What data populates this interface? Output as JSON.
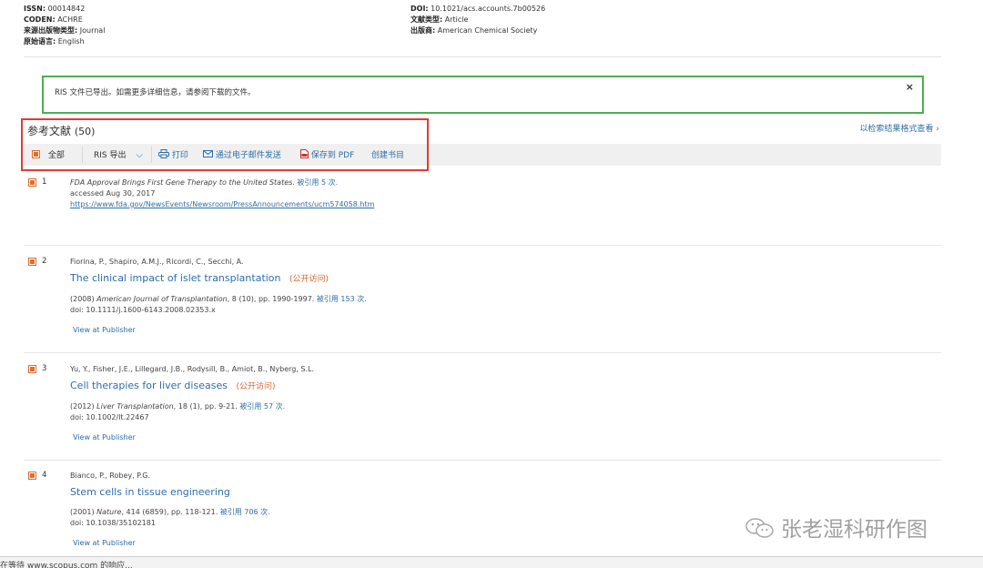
{
  "record_meta": {
    "left": [
      {
        "key": "ISSN:",
        "value": "00014842"
      },
      {
        "key": "CODEN:",
        "value": "ACHRE"
      },
      {
        "key": "来源出版物类型:",
        "value": "Journal"
      },
      {
        "key": "原始语言:",
        "value": "English"
      }
    ],
    "right": [
      {
        "key": "DOI:",
        "value": "10.1021/acs.accounts.7b00526"
      },
      {
        "key": "文献类型:",
        "value": "Article"
      },
      {
        "key": "出版商:",
        "value": "American Chemical Society"
      }
    ]
  },
  "notice": {
    "text": "RIS 文件已导出。如需更多详细信息，请参阅下载的文件。",
    "close": "×"
  },
  "references": {
    "title": "参考文献",
    "count": "(50)",
    "view_link": "以检索结果格式查看 ›"
  },
  "toolbar": {
    "select_all": "全部",
    "ris_export": "RIS 导出",
    "chevron": "⌵",
    "print": "打印",
    "email": "通过电子邮件发送",
    "save_pdf": "保存到 PDF",
    "create_bib": "创建书目"
  },
  "refs": [
    {
      "num": "1",
      "line1_italic": "FDA Approval Brings First Gene Therapy to the United States.",
      "line1_cited": "被引用 5 次.",
      "line2": "accessed Aug 30, 2017",
      "url": "https://www.fda.gov/NewsEvents/Newsroom/PressAnnouncements/ucm574058.htm"
    },
    {
      "num": "2",
      "authors": "Fiorina, P., Shapiro, A.M.J., Ricordi, C., Secchi, A.",
      "title": "The clinical impact of islet transplantation",
      "oa": "(公开访问)",
      "src_year": "(2008)",
      "src_journal": "American Journal of Transplantation",
      "src_detail": ", 8 (10), pp. 1990-1997.",
      "cited": "被引用 153 次.",
      "doi": "doi: 10.1111/j.1600-6143.2008.02353.x",
      "view": "View at Publisher"
    },
    {
      "num": "3",
      "authors": "Yu, Y., Fisher, J.E., Lillegard, J.B., Rodysill, B., Amiot, B., Nyberg, S.L.",
      "title": "Cell therapies for liver diseases",
      "oa": "(公开访问)",
      "src_year": "(2012)",
      "src_journal": "Liver Transplantation",
      "src_detail": ", 18 (1), pp. 9-21.",
      "cited": "被引用 57 次.",
      "doi": "doi: 10.1002/lt.22467",
      "view": "View at Publisher"
    },
    {
      "num": "4",
      "authors": "Bianco, P., Robey, P.G.",
      "title": "Stem cells in tissue engineering",
      "src_year": "(2001)",
      "src_journal": "Nature",
      "src_detail": ", 414 (6859), pp. 118-121.",
      "cited": "被引用 706 次.",
      "doi": "doi: 10.1038/35102181",
      "view": "View at Publisher"
    }
  ],
  "watermark": {
    "text": "张老湿科研作图",
    "icon": "wechat-icon"
  },
  "status_bar": {
    "text": "在等待 www.scopus.com 的响应..."
  },
  "colors": {
    "accent": "#2e6ea9",
    "open_access": "#d9642b",
    "notice_border": "#4caf50",
    "highlight": "#e53935",
    "checkbox": "#e06c2c"
  }
}
